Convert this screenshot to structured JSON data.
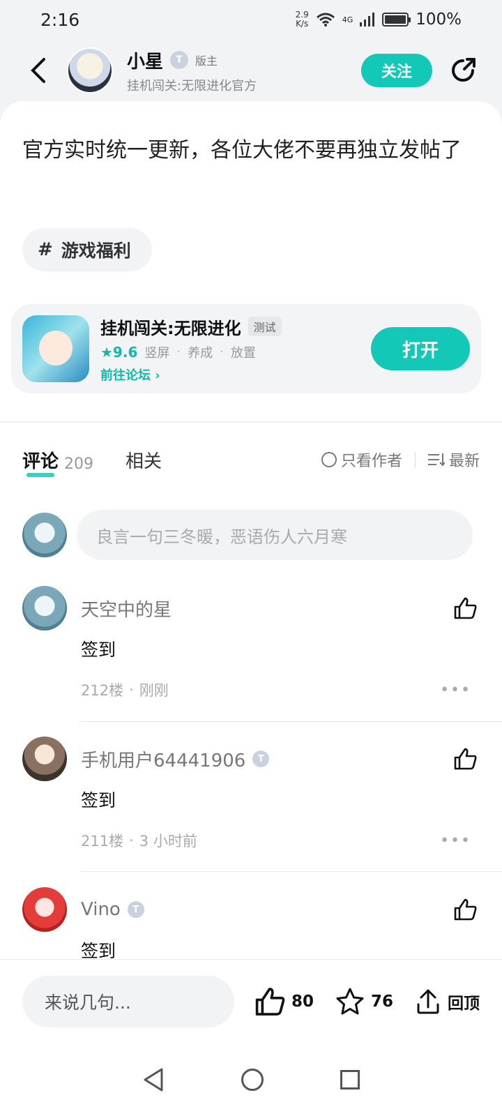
{
  "status_bar": {
    "time": "2:16",
    "net_speed_top": "2.9",
    "net_speed_bottom": "K/s",
    "network": "4G",
    "battery": "100%"
  },
  "header": {
    "author_name": "小星",
    "author_level": "T",
    "author_role": "版主",
    "author_subtitle": "挂机闯关:无限进化官方",
    "follow_label": "关注"
  },
  "post": {
    "title": "官方实时统一更新，各位大佬不要再独立发帖了",
    "topic_hash": "#",
    "topic": "游戏福利"
  },
  "game": {
    "title": "挂机闯关:无限进化",
    "tag": "测试",
    "rating": "★9.6",
    "genres": [
      "竖屏",
      "养成",
      "放置"
    ],
    "forum_link": "前往论坛 ›",
    "open_label": "打开"
  },
  "tabs": {
    "comments_label": "评论",
    "comments_count": "209",
    "related_label": "相关",
    "author_only": "只看作者",
    "sort_label": "最新"
  },
  "comment_input_placeholder": "良言一句三冬暖，恶语伤人六月寒",
  "comments": [
    {
      "name": "天空中的星",
      "badge": "",
      "body": "签到",
      "floor": "212楼",
      "time": "刚刚"
    },
    {
      "name": "手机用户64441906",
      "badge": "T",
      "body": "签到",
      "floor": "211楼",
      "time": "3 小时前"
    },
    {
      "name": "Vino",
      "badge": "T",
      "body": "签到",
      "floor": "",
      "time": ""
    }
  ],
  "bottom_bar": {
    "input_placeholder": "来说几句...",
    "likes": "80",
    "favorites": "76",
    "back_to_top": "回顶"
  },
  "colors": {
    "accent": "#14c8b8",
    "background": "#f2f3f5"
  }
}
